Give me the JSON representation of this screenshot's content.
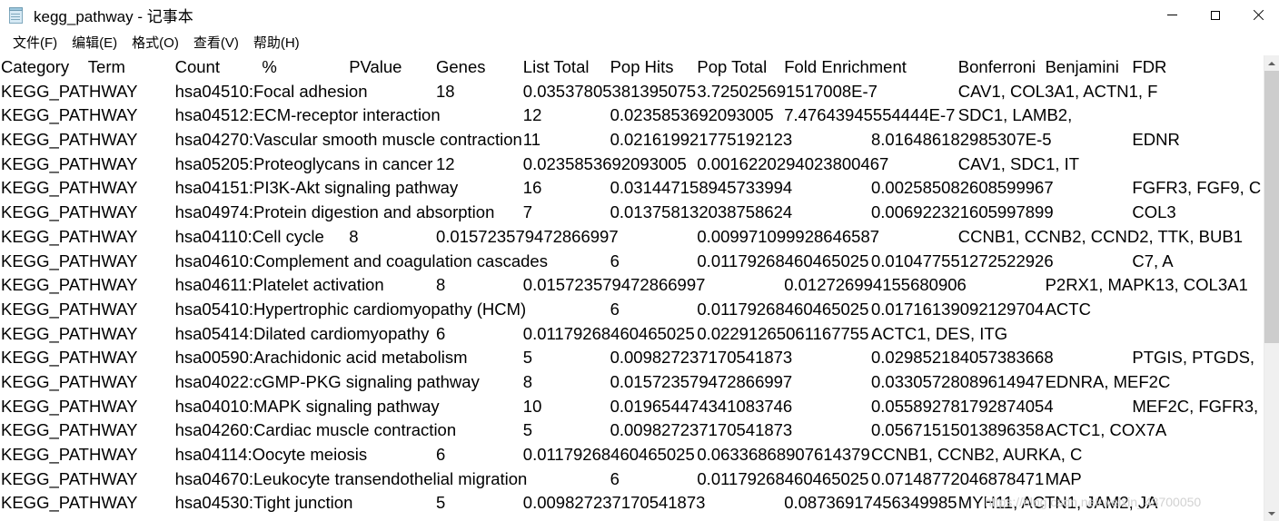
{
  "window": {
    "title": "kegg_pathway - 记事本",
    "app_icon": "notepad-icon",
    "buttons": {
      "minimize": "minimize-icon",
      "maximize": "maximize-icon",
      "close": "close-icon"
    }
  },
  "menubar": {
    "items": [
      {
        "label": "文件(F)",
        "name": "file"
      },
      {
        "label": "编辑(E)",
        "name": "edit"
      },
      {
        "label": "格式(O)",
        "name": "format"
      },
      {
        "label": "查看(V)",
        "name": "view"
      },
      {
        "label": "帮助(H)",
        "name": "help"
      }
    ]
  },
  "document": {
    "columns": [
      "Category",
      "Term",
      "Count",
      "%",
      "PValue",
      "Genes",
      "List Total",
      "Pop Hits",
      "Pop Total",
      "Fold Enrichment",
      "Bonferroni",
      "Benjamini",
      "FDR"
    ],
    "header_line": "Category\tTerm\tCount\t%\tPValue\tGenes\tList Total\tPop Hits\tPop Total\tFold Enrichment\tBonferroni\tBenjamini\tFDR",
    "lines": [
      "Category\tTerm\tCount\t%\tPValue\tGenes\tList Total\tPop Hits\tPop Total\tFold Enrichment\tBonferroni\tBenjamini\tFDR",
      "KEGG_PATHWAY\thsa04510:Focal adhesion\t18\t0.03537805381395075\t3.725025691517008E-7\tCAV1, COL3A1, ACTN1, F",
      "KEGG_PATHWAY\thsa04512:ECM-receptor interaction\t12\t0.0235853692093005\t7.47643945554444E-7\tSDC1, LAMB2,",
      "KEGG_PATHWAY\thsa04270:Vascular smooth muscle contraction\t11\t0.021619921775192123\t8.016486182985307E-5\tEDNR",
      "KEGG_PATHWAY\thsa05205:Proteoglycans in cancer\t12\t0.0235853692093005\t0.0016220294023800467\tCAV1, SDC1, IT",
      "KEGG_PATHWAY\thsa04151:PI3K-Akt signaling pathway\t16\t0.031447158945733994\t0.002585082608599967\tFGFR3, FGF9, C",
      "KEGG_PATHWAY\thsa04974:Protein digestion and absorption\t7\t0.013758132038758624\t0.006922321605997899\tCOL3",
      "KEGG_PATHWAY\thsa04110:Cell cycle\t8\t0.015723579472866997\t0.009971099928646587\tCCNB1, CCNB2, CCND2, TTK, BUB1",
      "KEGG_PATHWAY\thsa04610:Complement and coagulation cascades\t6\t0.01179268460465025\t0.010477551272522926\tC7, A",
      "KEGG_PATHWAY\thsa04611:Platelet activation\t8\t0.015723579472866997\t0.012726994155680906\tP2RX1, MAPK13, COL3A1",
      "KEGG_PATHWAY\thsa05410:Hypertrophic cardiomyopathy (HCM)\t6\t0.01179268460465025\t0.01716139092129704\tACTC",
      "KEGG_PATHWAY\thsa05414:Dilated cardiomyopathy\t6\t0.01179268460465025\t0.02291265061167755\tACTC1, DES, ITG",
      "KEGG_PATHWAY\thsa00590:Arachidonic acid metabolism\t5\t0.009827237170541873\t0.029852184057383668\tPTGIS, PTGDS,",
      "KEGG_PATHWAY\thsa04022:cGMP-PKG signaling pathway\t8\t0.015723579472866997\t0.03305728089614947\tEDNRA, MEF2C",
      "KEGG_PATHWAY\thsa04010:MAPK signaling pathway\t10\t0.019654474341083746\t0.055892781792874054\tMEF2C, FGFR3,",
      "KEGG_PATHWAY\thsa04260:Cardiac muscle contraction\t5\t0.009827237170541873\t0.05671515013896358\tACTC1, COX7A",
      "KEGG_PATHWAY\thsa04114:Oocyte meiosis\t6\t0.01179268460465025\t0.06336868907614379\tCCNB1, CCNB2, AURKA, C",
      "KEGG_PATHWAY\thsa04670:Leukocyte transendothelial migration\t6\t0.01179268460465025\t0.07148772046878471\tMAP",
      "KEGG_PATHWAY\thsa04530:Tight junction\t5\t0.009827237170541873\t0.08736917456349985\tMYH11, ACTN1, JAM2, JA"
    ],
    "rows": [
      {
        "category": "KEGG_PATHWAY",
        "term": "hsa04510:Focal adhesion",
        "count": "18",
        "percent": "0.03537805381395075",
        "pvalue": "3.725025691517008E-7",
        "genes": "CAV1, COL3A1, ACTN1, F"
      },
      {
        "category": "KEGG_PATHWAY",
        "term": "hsa04512:ECM-receptor interaction",
        "count": "12",
        "percent": "0.0235853692093005",
        "pvalue": "7.47643945554444E-7",
        "genes": "SDC1, LAMB2,"
      },
      {
        "category": "KEGG_PATHWAY",
        "term": "hsa04270:Vascular smooth muscle contraction",
        "count": "11",
        "percent": "0.021619921775192123",
        "pvalue": "8.016486182985307E-5",
        "genes": "EDNR"
      },
      {
        "category": "KEGG_PATHWAY",
        "term": "hsa05205:Proteoglycans in cancer",
        "count": "12",
        "percent": "0.0235853692093005",
        "pvalue": "0.0016220294023800467",
        "genes": "CAV1, SDC1, IT"
      },
      {
        "category": "KEGG_PATHWAY",
        "term": "hsa04151:PI3K-Akt signaling pathway",
        "count": "16",
        "percent": "0.031447158945733994",
        "pvalue": "0.002585082608599967",
        "genes": "FGFR3, FGF9, C"
      },
      {
        "category": "KEGG_PATHWAY",
        "term": "hsa04974:Protein digestion and absorption",
        "count": "7",
        "percent": "0.013758132038758624",
        "pvalue": "0.006922321605997899",
        "genes": "COL3"
      },
      {
        "category": "KEGG_PATHWAY",
        "term": "hsa04110:Cell cycle",
        "count": "8",
        "percent": "0.015723579472866997",
        "pvalue": "0.009971099928646587",
        "genes": "CCNB1, CCNB2, CCND2, TTK, BUB1"
      },
      {
        "category": "KEGG_PATHWAY",
        "term": "hsa04610:Complement and coagulation cascades",
        "count": "6",
        "percent": "0.01179268460465025",
        "pvalue": "0.010477551272522926",
        "genes": "C7, A"
      },
      {
        "category": "KEGG_PATHWAY",
        "term": "hsa04611:Platelet activation",
        "count": "8",
        "percent": "0.015723579472866997",
        "pvalue": "0.012726994155680906",
        "genes": "P2RX1, MAPK13, COL3A1"
      },
      {
        "category": "KEGG_PATHWAY",
        "term": "hsa05410:Hypertrophic cardiomyopathy (HCM)",
        "count": "6",
        "percent": "0.01179268460465025",
        "pvalue": "0.01716139092129704",
        "genes": "ACTC"
      },
      {
        "category": "KEGG_PATHWAY",
        "term": "hsa05414:Dilated cardiomyopathy",
        "count": "6",
        "percent": "0.01179268460465025",
        "pvalue": "0.02291265061167755",
        "genes": "ACTC1, DES, ITG"
      },
      {
        "category": "KEGG_PATHWAY",
        "term": "hsa00590:Arachidonic acid metabolism",
        "count": "5",
        "percent": "0.009827237170541873",
        "pvalue": "0.029852184057383668",
        "genes": "PTGIS, PTGDS,"
      },
      {
        "category": "KEGG_PATHWAY",
        "term": "hsa04022:cGMP-PKG signaling pathway",
        "count": "8",
        "percent": "0.015723579472866997",
        "pvalue": "0.03305728089614947",
        "genes": "EDNRA, MEF2C"
      },
      {
        "category": "KEGG_PATHWAY",
        "term": "hsa04010:MAPK signaling pathway",
        "count": "10",
        "percent": "0.019654474341083746",
        "pvalue": "0.055892781792874054",
        "genes": "MEF2C, FGFR3,"
      },
      {
        "category": "KEGG_PATHWAY",
        "term": "hsa04260:Cardiac muscle contraction",
        "count": "5",
        "percent": "0.009827237170541873",
        "pvalue": "0.05671515013896358",
        "genes": "ACTC1, COX7A"
      },
      {
        "category": "KEGG_PATHWAY",
        "term": "hsa04114:Oocyte meiosis",
        "count": "6",
        "percent": "0.01179268460465025",
        "pvalue": "0.06336868907614379",
        "genes": "CCNB1, CCNB2, AURKA, C"
      },
      {
        "category": "KEGG_PATHWAY",
        "term": "hsa04670:Leukocyte transendothelial migration",
        "count": "6",
        "percent": "0.01179268460465025",
        "pvalue": "0.07148772046878471",
        "genes": "MAP"
      },
      {
        "category": "KEGG_PATHWAY",
        "term": "hsa04530:Tight junction",
        "count": "5",
        "percent": "0.009827237170541873",
        "pvalue": "0.08736917456349985",
        "genes": "MYH11, ACTN1, JAM2, JA"
      }
    ]
  },
  "watermark": {
    "text": "https://blog.csdn.net/weixin_43700050"
  },
  "scrollbar": {
    "up_arrow": "scroll-up-icon",
    "down_arrow": "scroll-down-icon"
  },
  "colors": {
    "background": "#ffffff",
    "text": "#000000",
    "scrollbar_track": "#f0f0f0",
    "scrollbar_thumb": "#cdcdcd",
    "watermark": "#d2d2d2"
  }
}
